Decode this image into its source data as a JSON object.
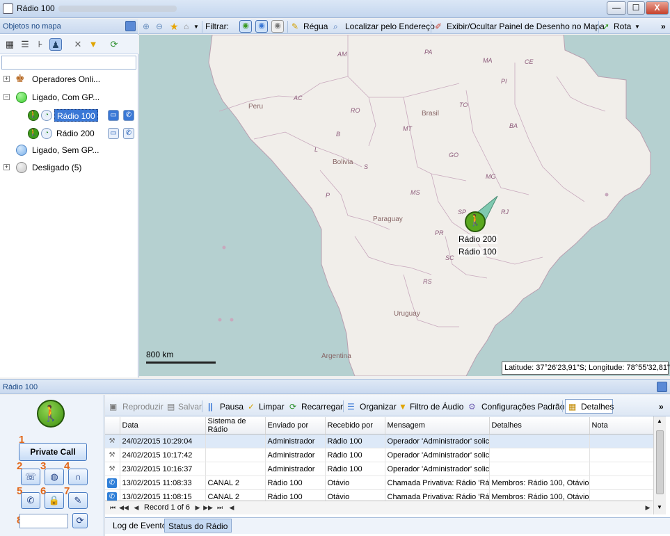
{
  "window": {
    "title": "Rádio 100",
    "minimize": "—",
    "maximize": "☐",
    "close": "X"
  },
  "left_panel": {
    "header": "Objetos no mapa",
    "tree": [
      {
        "label": "Operadores Onli...",
        "expander": "+"
      },
      {
        "label": "Ligado, Com GP...",
        "expander": "−",
        "color": "#3fcf32"
      },
      {
        "label": "Rádio 100",
        "selected": true
      },
      {
        "label": "Rádio 200"
      },
      {
        "label": "Ligado, Sem GP...",
        "color": "#7db2ea"
      },
      {
        "label": "Desligado (5)",
        "expander": "+",
        "color": "#c8c8c8"
      }
    ]
  },
  "map_toolbar": {
    "filter_label": "Filtrar:",
    "ruler": "Régua",
    "locate": "Localizar pelo Endereço",
    "drawing_panel": "Exibir/Ocultar Painel de Desenho no Mapa",
    "route": "Rota",
    "overflow": "»"
  },
  "map": {
    "country_labels": [
      "Peru",
      "Brasil",
      "Bolivia",
      "Paraguay",
      "Uruguay",
      "Argentina"
    ],
    "state_labels": [
      "AM",
      "PA",
      "MA",
      "CE",
      "PI",
      "AC",
      "RO",
      "TO",
      "MT",
      "BA",
      "GO",
      "MG",
      "MS",
      "SP",
      "RJ",
      "PR",
      "SC",
      "RS",
      "B",
      "L",
      "S",
      "P"
    ],
    "marker_labels": [
      "Rádio 200",
      "Rádio 100"
    ],
    "scale": "800 km",
    "coordinates": "Latitude: 37°26'23,91\"S; Longitude: 78°55'32,81\"W"
  },
  "bottom_panel": {
    "header": "Rádio 100",
    "private_call": "Private Call",
    "numbers": [
      "1",
      "2",
      "3",
      "4",
      "5",
      "6",
      "7",
      "8"
    ]
  },
  "log_toolbar": {
    "play": "Reproduzir",
    "save": "Salvar",
    "pause": "Pausa",
    "clear": "Limpar",
    "reload": "Recarregar",
    "organize": "Organizar",
    "audio_filter": "Filtro de Áudio",
    "default_settings": "Configurações Padrão",
    "details": "Detalhes",
    "overflow": "»"
  },
  "log_table": {
    "columns": [
      "Data",
      "Sistema de Rádio",
      "Enviado por",
      "Recebido por",
      "Mensagem",
      "Detalhes",
      "Nota"
    ],
    "rows": [
      {
        "icon": "tools-icon",
        "cells": [
          "24/02/2015 10:29:04",
          "",
          "Administrador",
          "Rádio 100",
          "Operador 'Administrador' solic...",
          "",
          ""
        ]
      },
      {
        "icon": "tools-icon",
        "cells": [
          "24/02/2015 10:17:42",
          "",
          "Administrador",
          "Rádio 100",
          "Operador 'Administrador' solic...",
          "",
          ""
        ]
      },
      {
        "icon": "tools-icon",
        "cells": [
          "23/02/2015 10:16:37",
          "",
          "Administrador",
          "Rádio 100",
          "Operador 'Administrador' solic...",
          "",
          ""
        ]
      },
      {
        "icon": "call-icon",
        "cells": [
          "13/02/2015 11:08:33",
          "CANAL 2",
          "Rádio 100",
          "Otávio",
          "Chamada Privativa: Rádio 'Rá...",
          "Membros: Rádio 100, Otávio",
          ""
        ]
      },
      {
        "icon": "call-icon",
        "cells": [
          "13/02/2015 11:08:15",
          "CANAL 2",
          "Rádio 100",
          "Otávio",
          "Chamada Privativa: Rádio 'Rá...",
          "Membros: Rádio 100, Otávio",
          ""
        ]
      }
    ],
    "pager": "Record 1 of 6"
  },
  "tabs": [
    "Log de Eventos",
    "Status do Rádio"
  ]
}
